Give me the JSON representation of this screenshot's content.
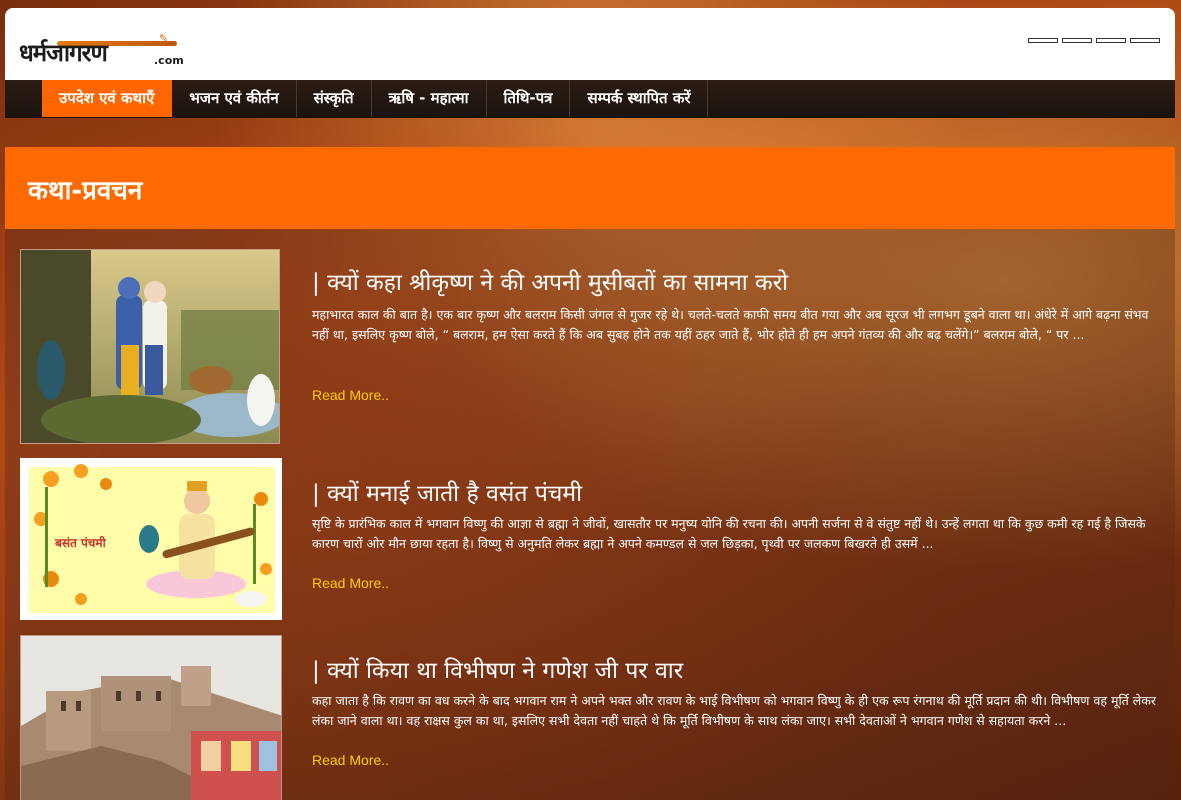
{
  "header": {
    "logo_text": "धर्मजागरण",
    "logo_suffix": ".com",
    "slider_dot_count": 4
  },
  "nav": {
    "items": [
      {
        "label": "उपदेश एवं कथाएँ",
        "active": true
      },
      {
        "label": "भजन एवं कीर्तन",
        "active": false
      },
      {
        "label": "संस्कृति",
        "active": false
      },
      {
        "label": "ऋषि - महात्मा",
        "active": false
      },
      {
        "label": "तिथि-पत्र",
        "active": false
      },
      {
        "label": "सम्पर्क स्थापित करें",
        "active": false
      }
    ]
  },
  "page": {
    "title": "कथा-प्रवचन"
  },
  "articles": [
    {
      "title": "| क्यों कहा श्रीकृष्ण ने की अपनी मुसीबतों का सामना करो",
      "excerpt": "महाभारत काल की बात है। एक बार कृष्ण और बलराम किसी जंगल से गुजर रहे थे। चलते-चलते काफी समय बीत गया और अब सूरज भी लगभग डूबने वाला था। अंधेरे में आगे बढ़ना संभव नहीं था, इसलिए कृष्ण बोले, “ बलराम, हम ऐसा करते हैं कि अब सुबह होने तक यहीं ठहर जाते हैं, भोर होते ही हम अपने गंतव्य की और बढ़ चलेंगे।” बलराम बोले, “ पर ...",
      "read_more": "Read More.."
    },
    {
      "title": "| क्यों मनाई जाती है वसंत पंचमी",
      "excerpt": "सृष्टि के प्रारंभिक काल में भगवान विष्णु की आज्ञा से ब्रह्मा ने जीवों, खासतौर पर मनुष्य योनि की रचना की। अपनी सर्जना से वे संतुष्ट नहीं थे। उन्हें लगता था कि कुछ कमी रह गई है जिसके कारण चारों ओर मौन छाया रहता है। विष्णु से अनुमति लेकर ब्रह्मा ने अपने कमण्डल से जल छिड़का, पृथ्वी पर जलकण बिखरते ही उसमें ...",
      "read_more": "Read More..",
      "thumb_text": "बसंत पंचमी"
    },
    {
      "title": "| क्यों किया था विभीषण ने गणेश जी पर वार",
      "excerpt": "कहा जाता है कि रावण का वध करने के बाद भगवान राम ने अपने भक्त और रावण के भाई विभीषण को भगवान विष्णु के ही एक रूप रंगनाथ की मूर्ति प्रदान की थी। विभीषण वह मूर्ति लेकर लंका जाने वाला था। वह राक्षस कुल का था, इसलिए सभी देवता नहीं चाहते थे कि मूर्ति विभीषण के साथ लंका जाए। सभी देवताओं ने भगवान गणेश से सहायता करने ...",
      "read_more": "Read More.."
    }
  ],
  "colors": {
    "accent": "#ff6a00",
    "nav_bg": "#1f1610",
    "read_more": "#ffcc00"
  }
}
